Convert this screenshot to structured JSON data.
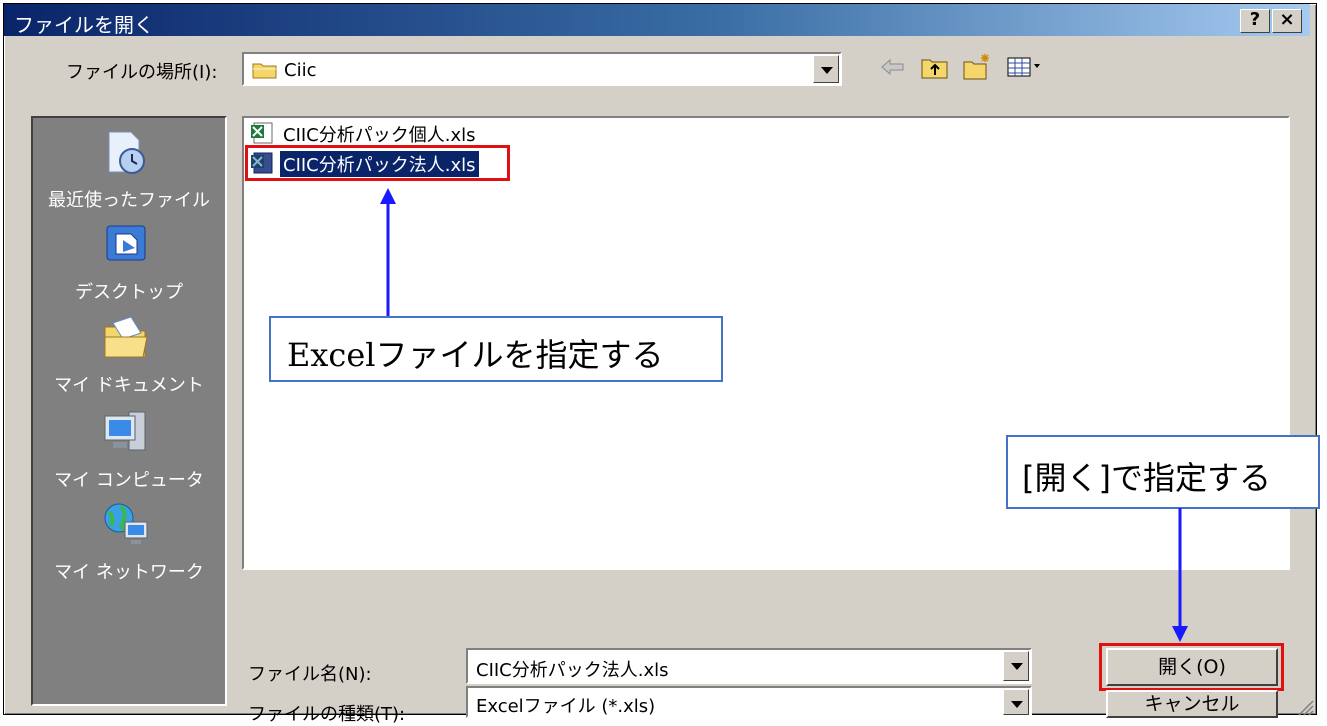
{
  "window": {
    "title": "ファイルを開く",
    "help_button": "?",
    "close_button": "×"
  },
  "look_in": {
    "label": "ファイルの場所(I):",
    "value": "Ciic"
  },
  "toolbar": {
    "icons": [
      "back-icon",
      "up-folder-icon",
      "new-folder-icon",
      "view-menu-icon"
    ]
  },
  "places": [
    {
      "label": "最近使ったファイル",
      "icon": "recent-documents-icon"
    },
    {
      "label": "デスクトップ",
      "icon": "desktop-icon"
    },
    {
      "label": "マイ ドキュメント",
      "icon": "my-documents-icon"
    },
    {
      "label": "マイ コンピュータ",
      "icon": "my-computer-icon"
    },
    {
      "label": "マイ ネットワーク",
      "icon": "my-network-icon"
    }
  ],
  "files": [
    {
      "name": "CIIC分析パック個人.xls",
      "selected": false
    },
    {
      "name": "CIIC分析パック法人.xls",
      "selected": true
    }
  ],
  "filename_field": {
    "label": "ファイル名(N):",
    "value": "CIIC分析パック法人.xls"
  },
  "filetype_field": {
    "label": "ファイルの種類(T):",
    "value": "Excelファイル (*.xls)"
  },
  "buttons": {
    "open": "開く(O)",
    "cancel": "キャンセル"
  },
  "annotations": {
    "callout_file": "Excelファイルを指定する",
    "callout_open": "[開く]で指定する",
    "highlight_color": "#e01010",
    "arrow_color": "#1a1aff"
  },
  "colors": {
    "title_start": "#0a246a",
    "title_end": "#a6caf0",
    "face": "#d4d0c8",
    "selection": "#0a246a"
  }
}
